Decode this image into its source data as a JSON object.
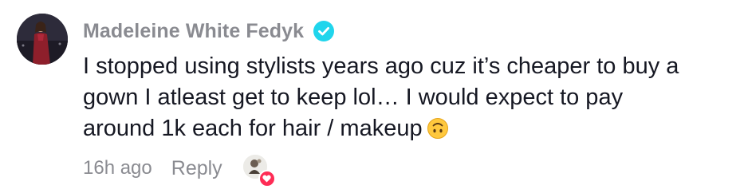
{
  "comment": {
    "username": "Madeleine White Fedyk",
    "verified": true,
    "text_lines": [
      "I stopped using stylists years ago cuz it’s cheaper to buy a",
      "gown I atleast get to keep lol… I would expect to pay",
      "around 1k each for hair / makeup"
    ],
    "emoji": "upside-down-face-emoji",
    "timestamp": "16h ago",
    "reply_label": "Reply"
  },
  "icons": {
    "verified": "verified-check-icon",
    "creator_liked": "heart-icon"
  },
  "colors": {
    "username": "#8a8b91",
    "text": "#161823",
    "meta": "#8a8b91",
    "verified_badge": "#20d5ec",
    "heart_badge": "#fe2c55",
    "emoji": "#ffc83d"
  }
}
